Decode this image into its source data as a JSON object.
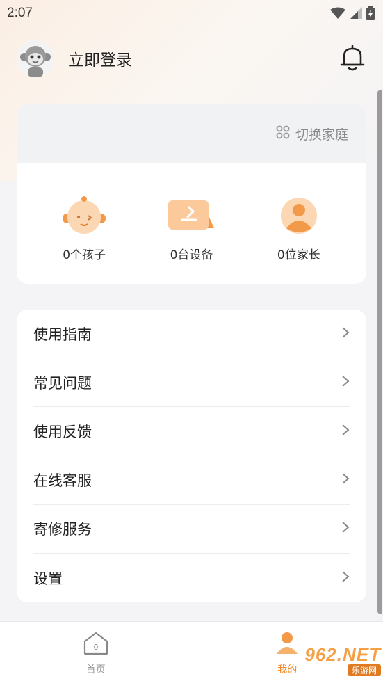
{
  "status": {
    "time": "2:07"
  },
  "header": {
    "login": "立即登录"
  },
  "family": {
    "switch_label": "切换家庭",
    "stats": [
      {
        "label": "0个孩子"
      },
      {
        "label": "0台设备"
      },
      {
        "label": "0位家长"
      }
    ]
  },
  "menu": {
    "items": [
      {
        "label": "使用指南"
      },
      {
        "label": "常见问题"
      },
      {
        "label": "使用反馈"
      },
      {
        "label": "在线客服"
      },
      {
        "label": "寄修服务"
      },
      {
        "label": "设置"
      }
    ]
  },
  "tabs": [
    {
      "label": "首页",
      "icon_digit": "0"
    },
    {
      "label": "我的"
    }
  ],
  "watermark": {
    "main": "962.NET",
    "sub": "乐游网"
  },
  "colors": {
    "accent": "#f08a2a",
    "background": "#f4f4f6"
  }
}
